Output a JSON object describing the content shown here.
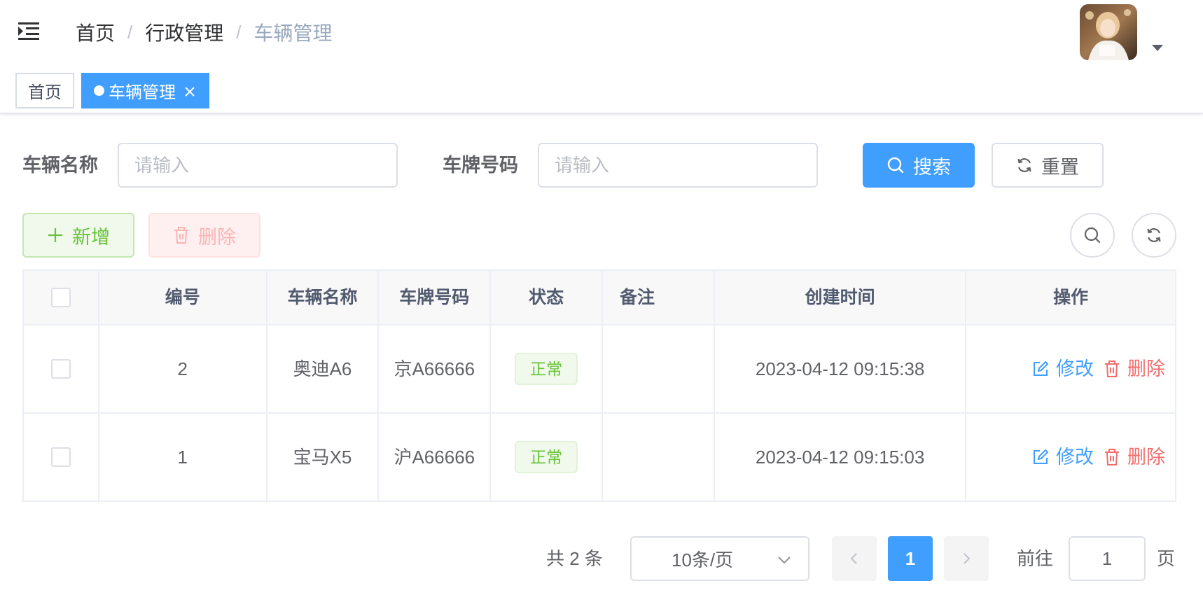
{
  "navbar": {
    "breadcrumb": [
      "首页",
      "行政管理",
      "车辆管理"
    ],
    "separator": "/"
  },
  "tags": {
    "home": "首页",
    "active": "车辆管理"
  },
  "search_form": {
    "vehicle_name_label": "车辆名称",
    "vehicle_name_placeholder": "请输入",
    "vehicle_name_value": "",
    "plate_label": "车牌号码",
    "plate_placeholder": "请输入",
    "plate_value": "",
    "search_button": "搜索",
    "reset_button": "重置"
  },
  "toolbar": {
    "add_button": "新增",
    "delete_button": "删除"
  },
  "table": {
    "columns": [
      "",
      "编号",
      "车辆名称",
      "车牌号码",
      "状态",
      "备注",
      "创建时间",
      "操作"
    ],
    "rows": [
      {
        "id": "2",
        "name": "奥迪A6",
        "plate": "京A66666",
        "status": "正常",
        "remark": "",
        "created": "2023-04-12 09:15:38",
        "edit": "修改",
        "delete": "删除"
      },
      {
        "id": "1",
        "name": "宝马X5",
        "plate": "沪A66666",
        "status": "正常",
        "remark": "",
        "created": "2023-04-12 09:15:03",
        "edit": "修改",
        "delete": "删除"
      }
    ]
  },
  "pagination": {
    "total_text": "共 2 条",
    "page_size": "10条/页",
    "current_page": "1",
    "goto_label": "前往",
    "goto_value": "1",
    "page_suffix": "页"
  },
  "colors": {
    "primary": "#409eff",
    "success": "#67c23a",
    "danger": "#f56c6c",
    "text": "#606266",
    "breadcrumb_current": "#97a8be"
  },
  "icons": [
    "hamburger-icon",
    "close-icon",
    "search-icon",
    "refresh-icon",
    "plus-icon",
    "trash-icon",
    "edit-icon",
    "chevron-down-icon",
    "chevron-left-icon",
    "chevron-right-icon",
    "caret-down-icon"
  ]
}
